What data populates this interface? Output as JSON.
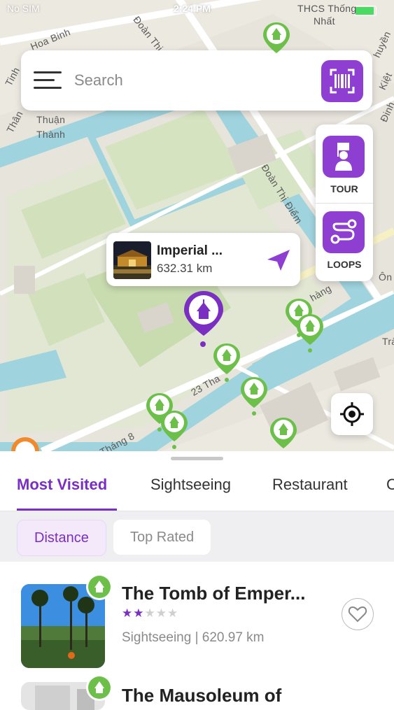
{
  "status_bar": {
    "carrier": "No SIM",
    "time": "2:24 PM"
  },
  "map": {
    "labels": {
      "hoa_binh": "Hoa Binh",
      "doan_thi_diem_top": "Đoàn Thị Điểm",
      "thcs": "THCS Thống",
      "nhat": "Nhất",
      "thuan": "Thuận",
      "thanh": "Thành",
      "doan_thi_diem_mid": "Đoàn Thị Điểm",
      "tinh": "Tinh",
      "than": "Thân",
      "huyen": "huyền",
      "kiet": "Kiệt",
      "dinh": "Đinh",
      "on": "Ôn",
      "tra": "Trà",
      "thang": "hàng",
      "thang_8": "Tháng 8",
      "street_23": "23 Tha"
    },
    "search": {
      "placeholder": "Search"
    },
    "side_buttons": {
      "tour": "TOUR",
      "loops": "LOOPS"
    },
    "popup": {
      "title": "Imperial ...",
      "distance": "632.31 km"
    },
    "colors": {
      "accent": "#8e3fd2",
      "pin_green": "#6cc04a",
      "water": "#9fd3de",
      "park": "#c9dcb0"
    }
  },
  "sheet": {
    "tabs": [
      {
        "label": "Most Visited",
        "active": true
      },
      {
        "label": "Sightseeing",
        "active": false
      },
      {
        "label": "Restaurant",
        "active": false
      },
      {
        "label": "C",
        "active": false
      }
    ],
    "filters": [
      {
        "label": "Distance",
        "active": true
      },
      {
        "label": "Top Rated",
        "active": false
      }
    ],
    "items": [
      {
        "title": "The Tomb of Emper...",
        "rating": 2,
        "category": "Sightseeing",
        "distance": "620.97 km",
        "meta": "Sightseeing | 620.97 km"
      },
      {
        "title": "The Mausoleum of",
        "rating": 0,
        "category": "",
        "distance": "",
        "meta": ""
      }
    ]
  }
}
